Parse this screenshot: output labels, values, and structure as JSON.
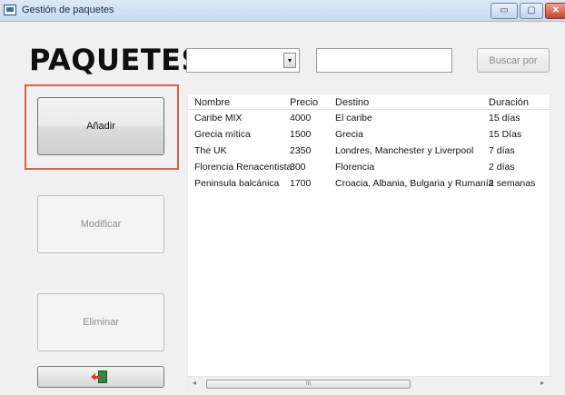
{
  "window": {
    "title": "Gestión de paquetes",
    "controls": {
      "minimize": "▭",
      "maximize": "▢",
      "close": "✕"
    }
  },
  "header": {
    "title": "PAQUETES",
    "combo_value": "",
    "combo_arrow": "▾",
    "search_value": "",
    "search_placeholder": "",
    "search_button": "Buscar por"
  },
  "actions": {
    "add": "Añadir",
    "modify": "Modificar",
    "delete": "Eliminar",
    "exit_icon": "exit-door-icon"
  },
  "table": {
    "columns": [
      "Nombre",
      "Precio",
      "Destino",
      "Duración"
    ],
    "rows": [
      [
        "Caribe MIX",
        "4000",
        "El caribe",
        "15 días"
      ],
      [
        "Grecia mítica",
        "1500",
        "Grecia",
        "15 Días"
      ],
      [
        "The UK",
        "2350",
        "Londres, Manchester y Liverpool",
        "7 días"
      ],
      [
        "Florencia Renacentista",
        "300",
        "Florencia",
        "2 días"
      ],
      [
        "Peninsula balcánica",
        "1700",
        "Croacia, Albania, Bulgaria y Rumanía",
        "2 semanas"
      ]
    ]
  },
  "scrollbar": {
    "left_arrow": "◂",
    "right_arrow": "▸",
    "grip": "III"
  },
  "colors": {
    "focus_ring": "#e06040",
    "titlebar": "#c9daef",
    "background": "#f0f0f0"
  }
}
